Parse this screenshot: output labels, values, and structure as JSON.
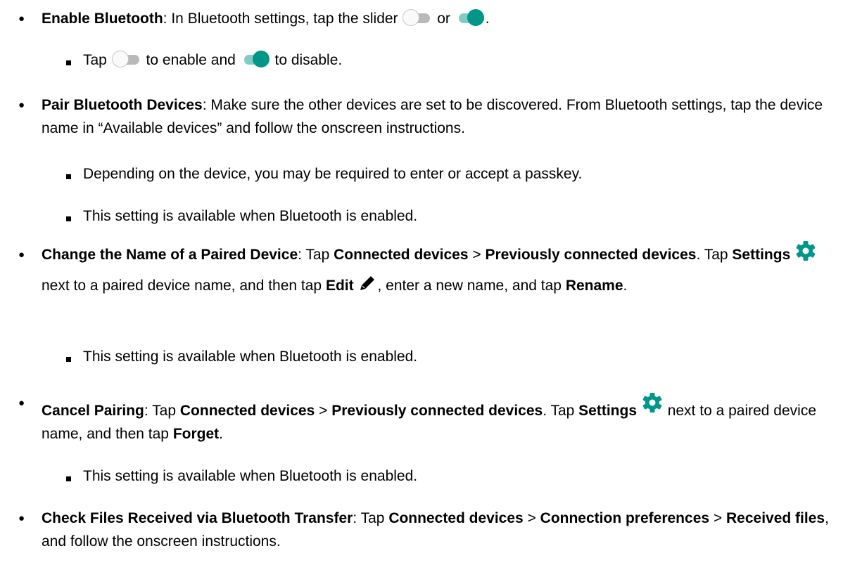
{
  "items": {
    "enable_bt": {
      "title": "Enable Bluetooth",
      "text_a": ": In Bluetooth settings, tap the slider ",
      "text_or": " or ",
      "text_end": "."
    },
    "enable_bt_sub": {
      "text_a": "Tap ",
      "text_b": " to enable and ",
      "text_c": " to disable."
    },
    "pair": {
      "title": "Pair Bluetooth Devices",
      "text_a": ": Make sure the other devices are set to be discovered. From Bluetooth settings, tap the device name in “Available devices” and follow the onscreen instructions."
    },
    "pair_sub1": "Depending on the device, you may be required to enter or accept a passkey.",
    "pair_sub2": "This setting is available when Bluetooth is enabled.",
    "rename": {
      "title": "Change the Name of a Paired Device",
      "text_a": ": Tap ",
      "b1": "Connected devices",
      "sep1": " > ",
      "b2": "Previously connected devices",
      "text_b": ". Tap ",
      "b3": "Settings",
      "text_c": " next to a paired device name, and then tap ",
      "b4": "Edit",
      "text_d": ", enter a new name, and tap ",
      "b5": "Rename",
      "text_e": "."
    },
    "rename_sub": "This setting is available when Bluetooth is enabled.",
    "cancel": {
      "title": "Cancel Pairing",
      "text_a": ": Tap ",
      "b1": "Connected devices",
      "sep1": " > ",
      "b2": "Previously connected devices",
      "text_b": ". Tap ",
      "b3": "Settings",
      "text_c": " next to a paired device name, and then tap ",
      "b4": "Forget",
      "text_d": "."
    },
    "cancel_sub": "This setting is available when Bluetooth is enabled.",
    "files": {
      "title": "Check Files Received via Bluetooth Transfer",
      "text_a": ": Tap ",
      "b1": "Connected devices",
      "sep1": " > ",
      "b2": "Connection preferences",
      "sep2": " > ",
      "b3": "Received files",
      "text_b": ", and follow the onscreen instructions."
    }
  },
  "bullet_l1": "●",
  "icons": {
    "toggle_off": "toggle-off-icon",
    "toggle_on": "toggle-on-icon",
    "gear": "gear-icon",
    "pencil": "pencil-icon"
  },
  "colors": {
    "toggle_on": "#009688",
    "toggle_on_track": "#80cbc4",
    "gear": "#009688",
    "text": "#000000"
  }
}
